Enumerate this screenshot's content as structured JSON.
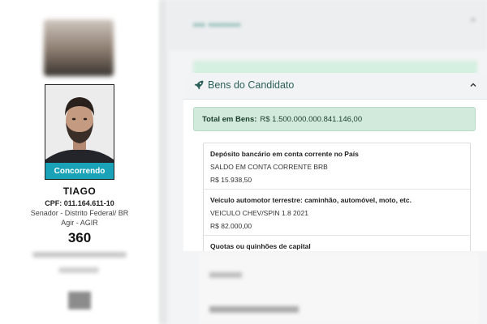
{
  "candidate": {
    "name": "TIAGO",
    "status": "Concorrendo",
    "cpf": "CPF: 011.164.611-10",
    "office": "Senador - Distrito Federal/ BR",
    "party": "Agir - AGIR",
    "number": "360"
  },
  "panel": {
    "title": "Bens do Candidato",
    "icon": "rocket-icon",
    "total_label": "Total em Bens:",
    "total_value": "R$ 1.500.000.000.841.146,00"
  },
  "assets": [
    {
      "type": "Depósito bancário em conta corrente no País",
      "description": "SALDO EM CONTA CORRENTE BRB",
      "value": "R$ 15.938,50"
    },
    {
      "type": "Veículo automotor terrestre: caminhão, automóvel, moto, etc.",
      "description": "VEICULO CHEV/SPIN 1.8 2021",
      "value": "R$ 82.000,00"
    },
    {
      "type": "Quotas ou quinhões de capital",
      "description": "",
      "value": ""
    }
  ],
  "colors": {
    "accent_teal": "#1aa3b8",
    "panel_title": "#2c5f5a",
    "total_bg": "#d1eadb"
  }
}
